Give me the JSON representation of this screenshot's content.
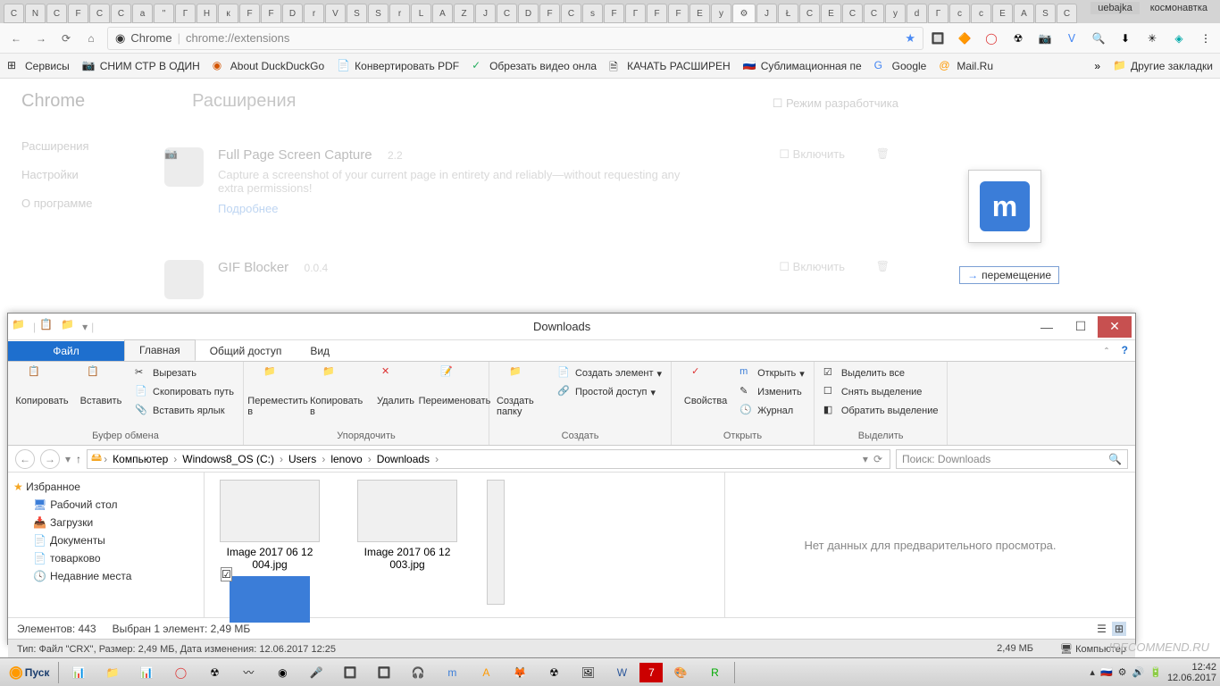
{
  "users": {
    "left": "uebajka",
    "right": "космонавтка"
  },
  "nav": {
    "chrome": "Chrome",
    "url": "chrome://extensions"
  },
  "bookmarks": {
    "apps": "Сервисы",
    "b1": "СНИМ СТР В ОДИН",
    "b2": "About DuckDuckGo",
    "b3": "Конвертировать PDF",
    "b4": "Обрезать видео онла",
    "b5": "КАЧАТЬ РАСШИРЕН",
    "b6": "Сублимационная пе",
    "b7": "Google",
    "b8": "Mail.Ru",
    "other": "Другие закладки"
  },
  "chrome": {
    "title": "Chrome",
    "page": "Расширения",
    "dev": "Режим разработчика",
    "side1": "Расширения",
    "side2": "Настройки",
    "side3": "О программе",
    "ext1": {
      "name": "Full Page Screen Capture",
      "ver": "2.2",
      "desc": "Capture a screenshot of your current page in entirety and reliably—without requesting any extra permissions!",
      "more": "Подробнее",
      "enable": "Включить"
    },
    "ext2": {
      "name": "GIF Blocker",
      "ver": "0.0.4",
      "enable": "Включить"
    }
  },
  "tooltip": "перемещение",
  "explorer": {
    "title": "Downloads",
    "tabs": {
      "file": "Файл",
      "home": "Главная",
      "share": "Общий доступ",
      "view": "Вид"
    },
    "ribbon": {
      "copy": "Копировать",
      "paste": "Вставить",
      "cut": "Вырезать",
      "copypath": "Скопировать путь",
      "pastesc": "Вставить ярлык",
      "g1": "Буфер обмена",
      "move": "Переместить в",
      "copyto": "Копировать в",
      "delete": "Удалить",
      "rename": "Переименовать",
      "g2": "Упорядочить",
      "newfolder": "Создать папку",
      "newitem": "Создать элемент",
      "easy": "Простой доступ",
      "g3": "Создать",
      "props": "Свойства",
      "open": "Открыть",
      "edit": "Изменить",
      "history": "Журнал",
      "g4": "Открыть",
      "selall": "Выделить все",
      "selnon": "Снять выделение",
      "selinv": "Обратить выделение",
      "g5": "Выделить"
    },
    "path": {
      "p1": "Компьютер",
      "p2": "Windows8_OS (C:)",
      "p3": "Users",
      "p4": "lenovo",
      "p5": "Downloads"
    },
    "search": "Поиск: Downloads",
    "nav": {
      "fav": "Избранное",
      "desk": "Рабочий стол",
      "dl": "Загрузки",
      "docs": "Документы",
      "tov": "товарково",
      "recent": "Недавние места"
    },
    "files": {
      "f1": "Image 2017 06 12 004.jpg",
      "f2": "Image 2017 06 12 003.jpg"
    },
    "preview": "Нет данных для предварительного просмотра.",
    "status": {
      "count": "Элементов: 443",
      "sel": "Выбран 1 элемент: 2,49 МБ"
    },
    "detail": {
      "info": "Тип: Файл \"CRX\", Размер: 2,49 МБ, Дата изменения: 12.06.2017 12:25",
      "size": "2,49 МБ",
      "comp": "Компьютер"
    }
  },
  "taskbar": {
    "start": "Пуск",
    "time": "12:42",
    "date": "12.06.2017"
  },
  "watermark": "IRECOMMEND.RU"
}
